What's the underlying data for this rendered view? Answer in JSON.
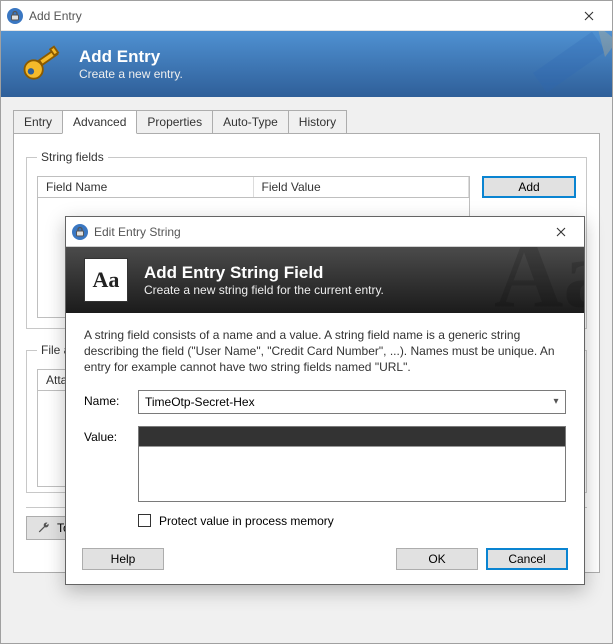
{
  "window": {
    "title": "Add Entry",
    "banner_title": "Add Entry",
    "banner_subtitle": "Create a new entry."
  },
  "tabs": [
    "Entry",
    "Advanced",
    "Properties",
    "Auto-Type",
    "History"
  ],
  "active_tab": "Advanced",
  "string_fields": {
    "legend": "String fields",
    "columns": {
      "name": "Field Name",
      "value": "Field Value"
    },
    "add_button": "Add"
  },
  "attachments": {
    "legend": "File attachments",
    "column": "Attachments"
  },
  "toolbar": {
    "tools_label": "Tools"
  },
  "modal": {
    "title": "Edit Entry String",
    "banner_title": "Add Entry String Field",
    "banner_subtitle": "Create a new string field for the current entry.",
    "description": "A string field consists of a name and a value. A string field name is a generic string describing the field (\"User Name\", \"Credit Card Number\", ...). Names must be unique. An entry for example cannot have two string fields named \"URL\".",
    "name_label": "Name:",
    "name_value": "TimeOtp-Secret-Hex",
    "value_label": "Value:",
    "protect_label": "Protect value in process memory",
    "help": "Help",
    "ok": "OK",
    "cancel": "Cancel"
  }
}
